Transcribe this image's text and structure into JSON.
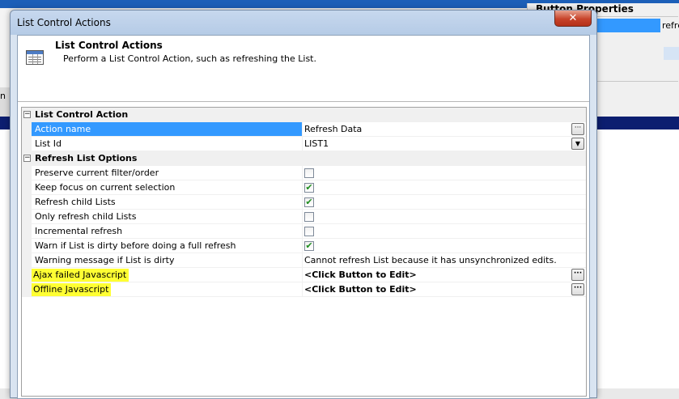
{
  "background": {
    "right_panel_title": "Button Properties",
    "right_panel_value": "refre",
    "left_letter": "n"
  },
  "dialog": {
    "title": "List Control Actions",
    "close_symbol": "✕",
    "header": {
      "title": "List Control Actions",
      "subtitle": "Perform a List Control Action, such as refreshing the List."
    }
  },
  "grid": {
    "categories": [
      {
        "label": "List Control Action",
        "expander": "−",
        "properties": [
          {
            "name": "Action name",
            "value": "Refresh Data",
            "editor": "ellipsis"
          },
          {
            "name": "List Id",
            "value": "LIST1",
            "editor": "dropdown"
          }
        ]
      },
      {
        "label": "Refresh List Options",
        "expander": "−",
        "properties": [
          {
            "name": "Preserve current filter/order",
            "checked": false
          },
          {
            "name": "Keep focus on current selection",
            "checked": true
          },
          {
            "name": "Refresh child Lists",
            "checked": true
          },
          {
            "name": "Only refresh child Lists",
            "checked": false
          },
          {
            "name": "Incremental refresh",
            "checked": false
          },
          {
            "name": "Warn if List is dirty before doing a full refresh",
            "checked": true
          },
          {
            "name": "Warning message if List is dirty",
            "value": "Cannot refresh List because it has unsynchronized edits."
          },
          {
            "name": "Ajax failed Javascript",
            "value": "<Click Button to Edit>",
            "editor": "ellipsis"
          },
          {
            "name": "Offline Javascript",
            "value": "<Click Button to Edit>",
            "editor": "ellipsis"
          }
        ]
      }
    ],
    "check_symbol": "✔",
    "ellipsis_symbol": "···",
    "dropdown_symbol": "▼"
  },
  "colors": {
    "selection": "#3399ff",
    "highlight": "#ffff33",
    "check": "#1f8d1f"
  }
}
